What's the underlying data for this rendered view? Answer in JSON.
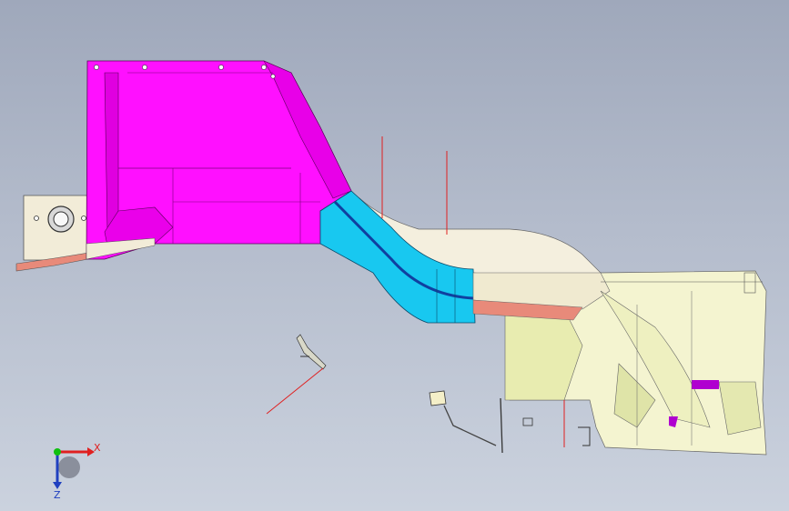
{
  "viewport": {
    "background_top": "#9fa8bb",
    "background_bottom": "#cbd2de"
  },
  "model": {
    "colors": {
      "magenta_part": "#ff10ff",
      "cyan_part": "#18c8f0",
      "pale_yellow_part": "#f4f4d0",
      "cream_part": "#f2ecd8",
      "salmon_part": "#e88a7a",
      "red_annotation": "#e02020",
      "purple_accent": "#b000d0"
    }
  },
  "triad": {
    "x_label": "X",
    "z_label": "Z",
    "x_color": "#e02020",
    "y_color": "#10c010",
    "z_color": "#2040c0"
  }
}
